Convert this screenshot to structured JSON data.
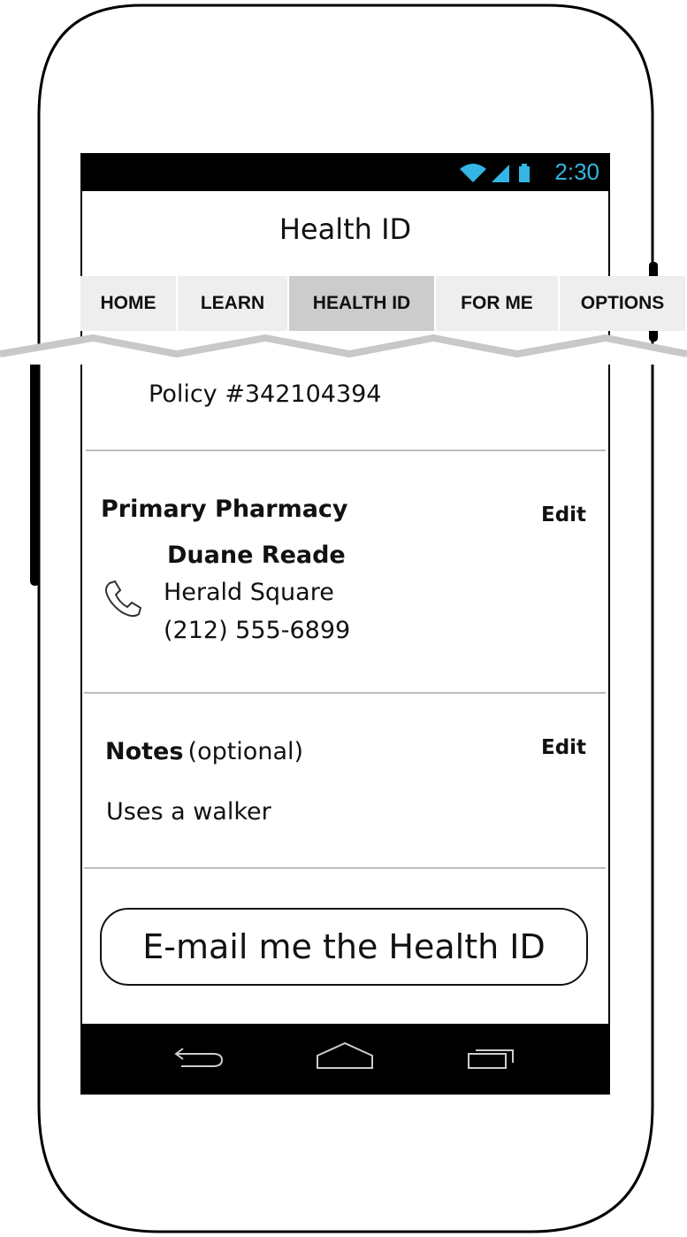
{
  "status_bar": {
    "time": "2:30",
    "time_color": "#33b5e5"
  },
  "app": {
    "title": "Health ID"
  },
  "tabs": [
    {
      "label": "HOME",
      "active": false
    },
    {
      "label": "LEARN",
      "active": false
    },
    {
      "label": "HEALTH ID",
      "active": true
    },
    {
      "label": "FOR ME",
      "active": false
    },
    {
      "label": "OPTIONS",
      "active": false
    }
  ],
  "policy": {
    "text": "Policy #342104394"
  },
  "pharmacy": {
    "section_title": "Primary Pharmacy",
    "edit_label": "Edit",
    "name": "Duane Reade",
    "location": "Herald Square",
    "phone": "(212) 555-6899",
    "phone_icon": "phone-icon"
  },
  "notes": {
    "section_title": "Notes",
    "qualifier": "(optional)",
    "edit_label": "Edit",
    "text": "Uses a walker"
  },
  "email_button": {
    "label": "E-mail me the Health ID"
  },
  "nav_bar": {
    "icons": [
      "back-icon",
      "home-icon",
      "recents-icon"
    ]
  }
}
